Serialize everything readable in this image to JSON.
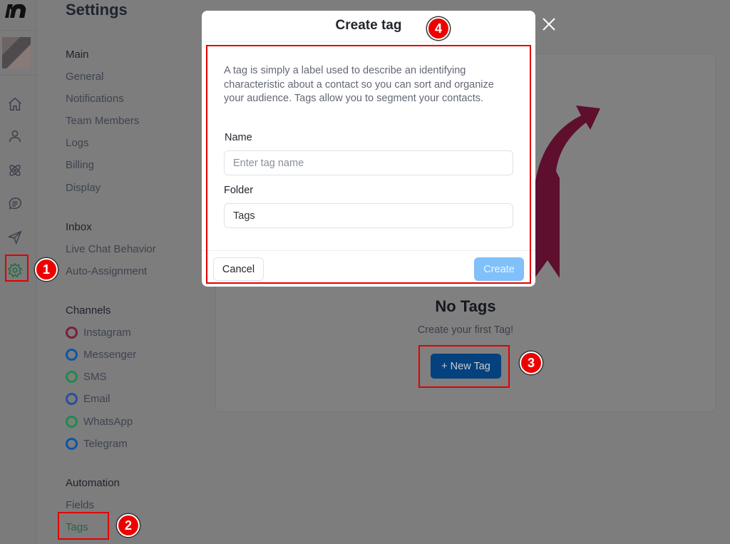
{
  "app": {
    "title": "Settings"
  },
  "rail": {
    "icons": [
      "home-icon",
      "user-icon",
      "atom-icon",
      "chat-icon",
      "send-icon",
      "gear-icon"
    ],
    "active": "gear-icon"
  },
  "nav": {
    "main": {
      "heading": "Main",
      "items": [
        "General",
        "Notifications",
        "Team Members",
        "Logs",
        "Billing",
        "Display"
      ]
    },
    "inbox": {
      "heading": "Inbox",
      "items": [
        "Live Chat Behavior",
        "Auto-Assignment"
      ]
    },
    "channels": {
      "heading": "Channels",
      "items": [
        {
          "label": "Instagram",
          "icon": "instagram-icon",
          "color": "#7a1f3d"
        },
        {
          "label": "Messenger",
          "icon": "messenger-icon",
          "color": "#0b56a8"
        },
        {
          "label": "SMS",
          "icon": "sms-icon",
          "color": "#1f8a4d"
        },
        {
          "label": "Email",
          "icon": "email-icon",
          "color": "#284f9a"
        },
        {
          "label": "WhatsApp",
          "icon": "whatsapp-icon",
          "color": "#1f8a4d"
        },
        {
          "label": "Telegram",
          "icon": "telegram-icon",
          "color": "#0b56a8"
        }
      ]
    },
    "automation": {
      "heading": "Automation",
      "items": [
        "Fields",
        "Tags"
      ],
      "active": "Tags"
    }
  },
  "main": {
    "empty_title": "No Tags",
    "empty_subtitle": "Create your first Tag!",
    "new_tag_label": "+ New Tag"
  },
  "modal": {
    "title": "Create tag",
    "description": "A tag is simply a label used to describe an identifying characteristic about a contact so you can sort and organize your audience. Tags allow you to segment your contacts.",
    "name_label": "Name",
    "name_placeholder": "Enter tag name",
    "name_value": "",
    "folder_label": "Folder",
    "folder_value": "Tags",
    "cancel_label": "Cancel",
    "create_label": "Create"
  },
  "annotations": {
    "badges": [
      "1",
      "2",
      "3",
      "4"
    ],
    "color": "#ee0000",
    "arrow_color": "#5e0f2e"
  }
}
